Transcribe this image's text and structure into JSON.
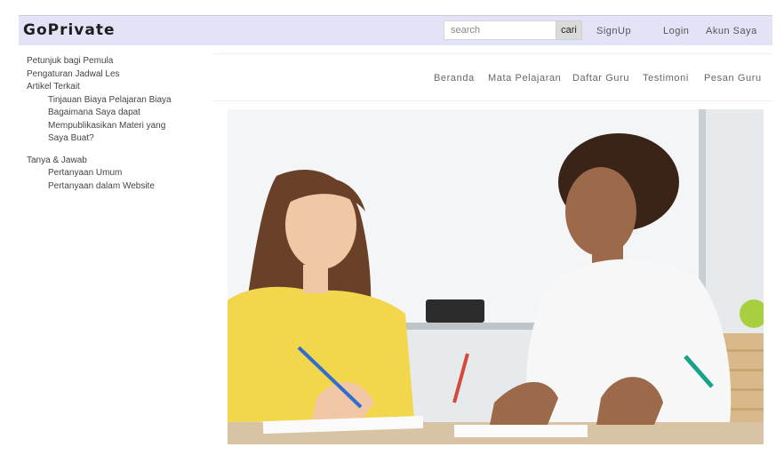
{
  "header": {
    "brand": "GoPrivate",
    "search_placeholder": "search",
    "search_button": "cari",
    "links": [
      "SignUp",
      "Login",
      "Akun Saya"
    ]
  },
  "sidebar": {
    "items": [
      {
        "label": "Petunjuk bagi Pemula"
      },
      {
        "label": "Pengaturan Jadwal Les"
      },
      {
        "label": "Artikel Terkait"
      }
    ],
    "artikel_sub": [
      "Tinjauan Biaya Pelajaran Biaya",
      "Bagaimana Saya dapat",
      "Mempublikasikan Materi yang",
      "Saya Buat?"
    ],
    "tanya_jawab": "Tanya & Jawab",
    "tanya_sub": [
      "Pertanyaan Umum",
      "Pertanyaan dalam Website"
    ]
  },
  "nav": {
    "items": [
      "Beranda",
      "Mata Pelajaran",
      "Daftar Guru",
      "Testimoni",
      "Pesan Guru"
    ]
  },
  "colors": {
    "topbar_bg": "#e3e3f7",
    "search_button_bg": "#dadada"
  }
}
